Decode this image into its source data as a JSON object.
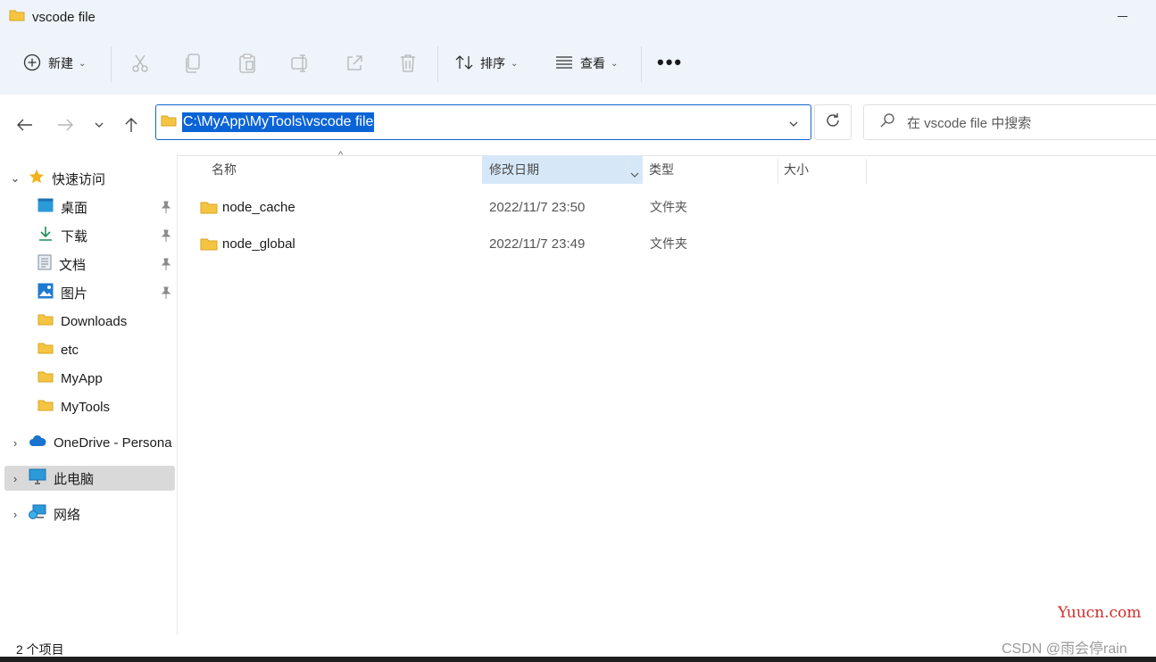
{
  "window": {
    "title": "vscode file"
  },
  "toolbar": {
    "new_label": "新建",
    "sort_label": "排序",
    "view_label": "查看",
    "more_label": "•••"
  },
  "address": {
    "path": "C:\\MyApp\\MyTools\\vscode file",
    "search_placeholder": "在 vscode file 中搜索"
  },
  "sidebar": {
    "quick_access": "快速访问",
    "items": [
      {
        "label": "桌面",
        "icon": "desktop-icon",
        "pinned": true
      },
      {
        "label": "下载",
        "icon": "download-icon",
        "pinned": true
      },
      {
        "label": "文档",
        "icon": "document-icon",
        "pinned": true
      },
      {
        "label": "图片",
        "icon": "picture-icon",
        "pinned": true
      },
      {
        "label": "Downloads",
        "icon": "folder-icon",
        "pinned": false
      },
      {
        "label": "etc",
        "icon": "folder-icon",
        "pinned": false
      },
      {
        "label": "MyApp",
        "icon": "folder-icon",
        "pinned": false
      },
      {
        "label": "MyTools",
        "icon": "folder-icon",
        "pinned": false
      }
    ],
    "onedrive": "OneDrive - Persona",
    "this_pc": "此电脑",
    "network": "网络"
  },
  "columns": {
    "name": "名称",
    "date": "修改日期",
    "type": "类型",
    "size": "大小"
  },
  "files": [
    {
      "name": "node_cache",
      "date": "2022/11/7 23:50",
      "type": "文件夹"
    },
    {
      "name": "node_global",
      "date": "2022/11/7 23:49",
      "type": "文件夹"
    }
  ],
  "status": {
    "count": "2 个项目"
  },
  "watermark": {
    "site": "Yuucn.com",
    "csdn": "CSDN @雨会停rain"
  },
  "colors": {
    "accent": "#0a64d6",
    "folder": "#f5c542",
    "chrome_bg": "#eef4f9",
    "selected_row": "#d9d9d9"
  }
}
